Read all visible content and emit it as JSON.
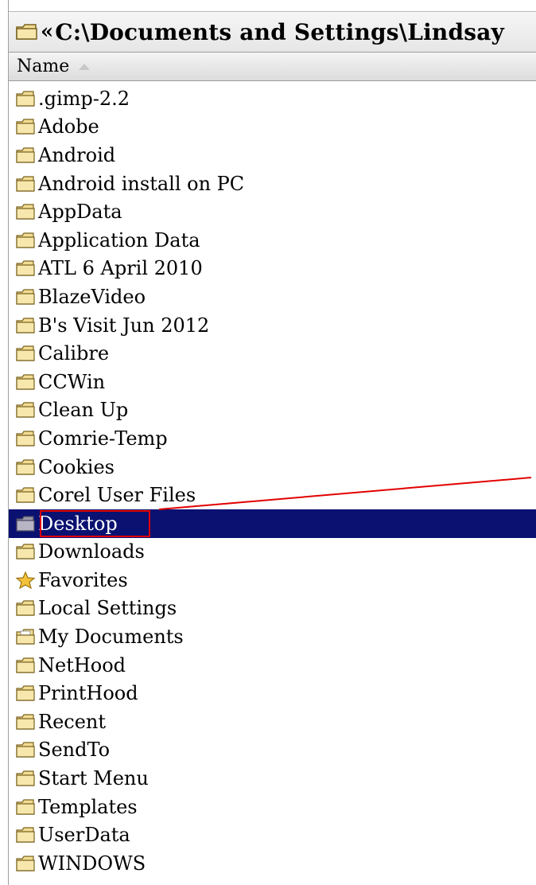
{
  "address_bar": {
    "chevron": "«",
    "path": "C:\\Documents and Settings\\Lindsay"
  },
  "columns": {
    "name_header": "Name",
    "sort": "ascending"
  },
  "items": [
    {
      "label": ".gimp-2.2",
      "icon": "folder-icon"
    },
    {
      "label": "Adobe",
      "icon": "folder-icon"
    },
    {
      "label": "Android",
      "icon": "folder-icon"
    },
    {
      "label": "Android install on PC",
      "icon": "folder-icon"
    },
    {
      "label": "AppData",
      "icon": "folder-icon"
    },
    {
      "label": "Application Data",
      "icon": "folder-icon"
    },
    {
      "label": "ATL 6 April 2010",
      "icon": "folder-icon"
    },
    {
      "label": "BlazeVideo",
      "icon": "folder-icon"
    },
    {
      "label": "B's Visit Jun 2012",
      "icon": "folder-icon"
    },
    {
      "label": "Calibre",
      "icon": "folder-icon"
    },
    {
      "label": "CCWin",
      "icon": "folder-icon"
    },
    {
      "label": "Clean Up",
      "icon": "folder-icon"
    },
    {
      "label": "Comrie-Temp",
      "icon": "folder-icon"
    },
    {
      "label": "Cookies",
      "icon": "folder-icon"
    },
    {
      "label": "Corel User Files",
      "icon": "folder-icon"
    },
    {
      "label": "Desktop",
      "icon": "desktop-folder-icon",
      "selected": true
    },
    {
      "label": "Downloads",
      "icon": "folder-icon"
    },
    {
      "label": "Favorites",
      "icon": "star-icon"
    },
    {
      "label": "Local Settings",
      "icon": "folder-icon"
    },
    {
      "label": "My Documents",
      "icon": "documents-folder-icon"
    },
    {
      "label": "NetHood",
      "icon": "folder-icon"
    },
    {
      "label": "PrintHood",
      "icon": "folder-icon"
    },
    {
      "label": "Recent",
      "icon": "folder-icon"
    },
    {
      "label": "SendTo",
      "icon": "folder-icon"
    },
    {
      "label": "Start Menu",
      "icon": "folder-icon"
    },
    {
      "label": "Templates",
      "icon": "folder-icon"
    },
    {
      "label": "UserData",
      "icon": "folder-icon"
    },
    {
      "label": "WINDOWS",
      "icon": "folder-icon"
    }
  ],
  "colors": {
    "selection": "#0a1171",
    "annotation": "#e20000",
    "folder_fill": "#f2dc93",
    "folder_stroke": "#7a6320"
  }
}
